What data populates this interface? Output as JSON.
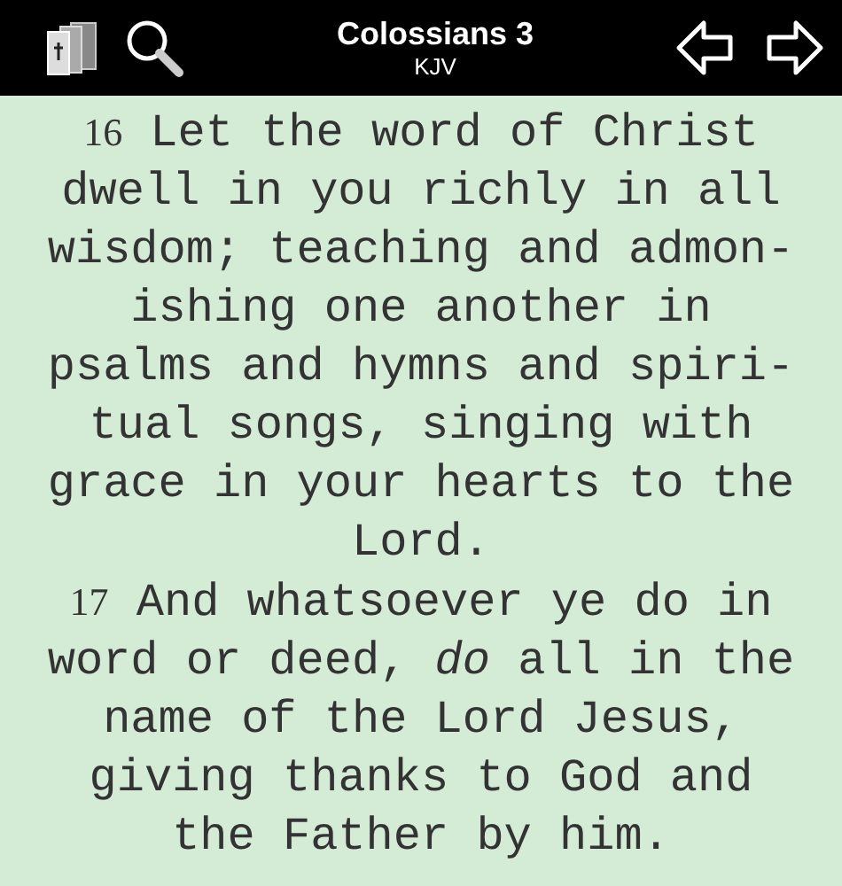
{
  "header": {
    "title": "Colossians 3",
    "subtitle": "KJV"
  },
  "verses": [
    {
      "number": "16",
      "lines": [
        "Let the word of Christ",
        "dwell in you richly in all",
        "wisdom; teaching and admon-",
        "ishing one another in",
        "psalms and hymns and spiri-",
        "tual songs, singing with",
        "grace in your hearts to the",
        "Lord."
      ]
    },
    {
      "number": "17",
      "lines": [
        "And whatsoever ye do in",
        "word or deed, *do* all in the",
        "name of the Lord Jesus,",
        "giving thanks to God and",
        "the Father by him."
      ]
    }
  ]
}
